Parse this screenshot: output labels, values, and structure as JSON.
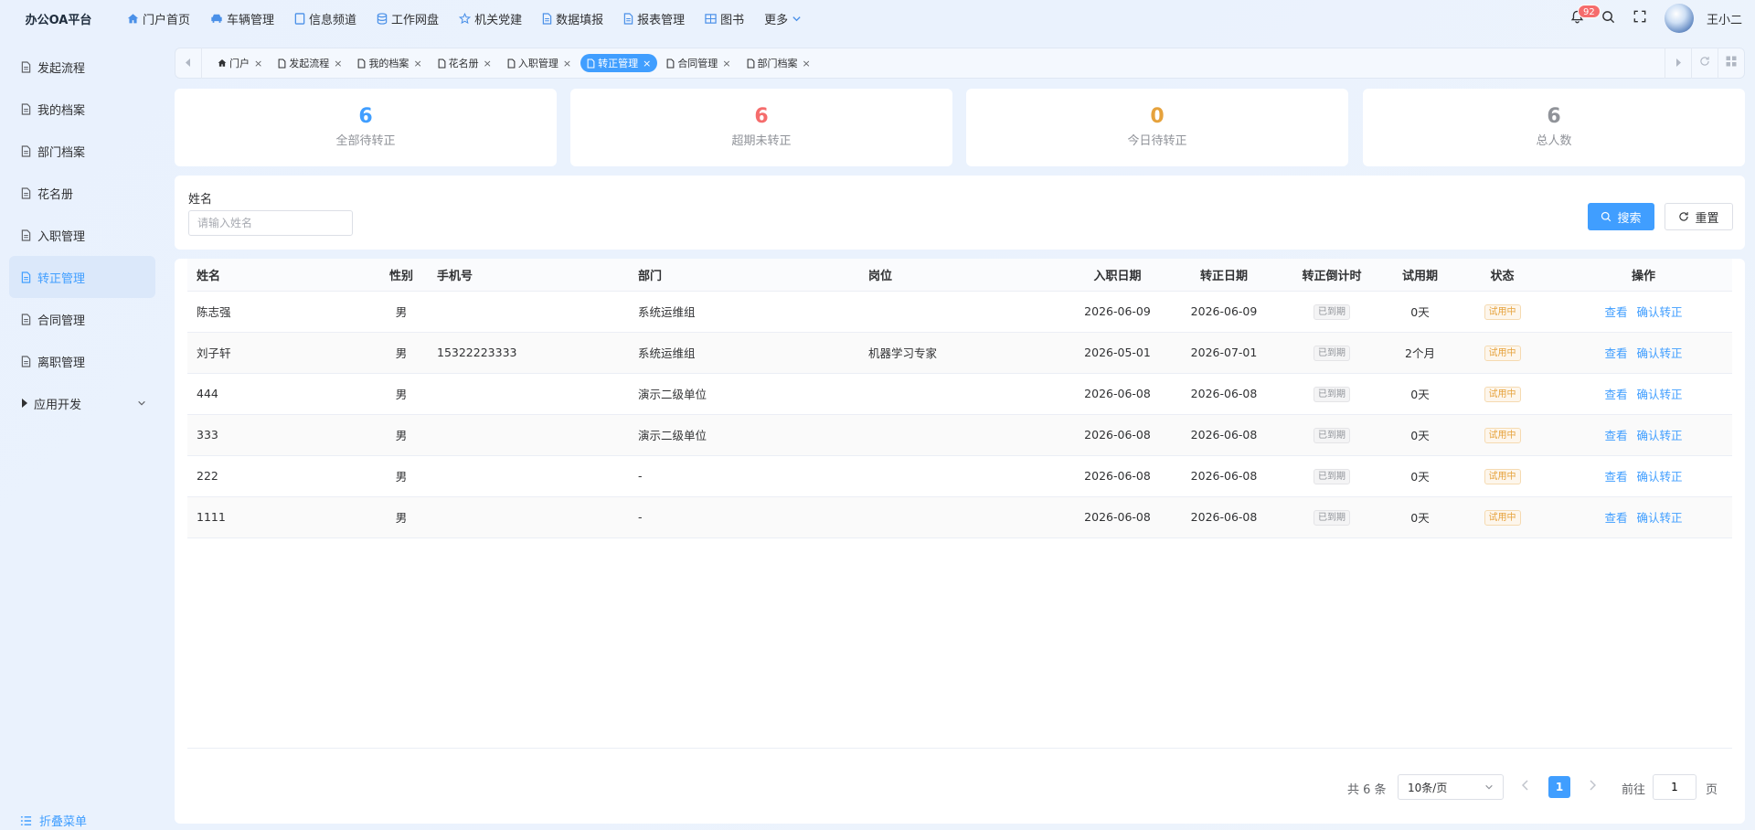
{
  "brand": "办公OA平台",
  "topnav": [
    {
      "label": "门户首页",
      "icon": "home-icon"
    },
    {
      "label": "车辆管理",
      "icon": "car-icon"
    },
    {
      "label": "信息频道",
      "icon": "channel-icon"
    },
    {
      "label": "工作网盘",
      "icon": "database-icon"
    },
    {
      "label": "机关党建",
      "icon": "star-icon"
    },
    {
      "label": "数据填报",
      "icon": "document-icon"
    },
    {
      "label": "报表管理",
      "icon": "document-icon"
    },
    {
      "label": "图书",
      "icon": "book-icon"
    },
    {
      "label": "更多",
      "icon": "chevron-down-icon"
    }
  ],
  "header": {
    "notification_count": "92",
    "username": "王小二"
  },
  "sidebar": {
    "items": [
      {
        "label": "发起流程"
      },
      {
        "label": "我的档案"
      },
      {
        "label": "部门档案"
      },
      {
        "label": "花名册"
      },
      {
        "label": "入职管理"
      },
      {
        "label": "转正管理",
        "active": true
      },
      {
        "label": "合同管理"
      },
      {
        "label": "离职管理"
      },
      {
        "label": "应用开发"
      }
    ],
    "collapse_label": "折叠菜单"
  },
  "tabs": [
    {
      "label": "门户",
      "icon": "home-icon"
    },
    {
      "label": "发起流程",
      "icon": "document-icon"
    },
    {
      "label": "我的档案",
      "icon": "document-icon"
    },
    {
      "label": "花名册",
      "icon": "document-icon"
    },
    {
      "label": "入职管理",
      "icon": "document-icon"
    },
    {
      "label": "转正管理",
      "icon": "document-icon",
      "active": true
    },
    {
      "label": "合同管理",
      "icon": "document-icon"
    },
    {
      "label": "部门档案",
      "icon": "document-icon"
    }
  ],
  "stats": [
    {
      "value": "6",
      "label": "全部待转正",
      "color": "#409eff"
    },
    {
      "value": "6",
      "label": "超期未转正",
      "color": "#f56c6c"
    },
    {
      "value": "0",
      "label": "今日待转正",
      "color": "#e6a23c"
    },
    {
      "value": "6",
      "label": "总人数",
      "color": "#909399"
    }
  ],
  "search": {
    "name_label": "姓名",
    "name_placeholder": "请输入姓名",
    "search_button": "搜索",
    "reset_button": "重置"
  },
  "table": {
    "headers": {
      "name": "姓名",
      "gender": "性别",
      "phone": "手机号",
      "dept": "部门",
      "post": "岗位",
      "entry_date": "入职日期",
      "regular_date": "转正日期",
      "countdown": "转正倒计时",
      "probation": "试用期",
      "status": "状态",
      "actions": "操作"
    },
    "rows": [
      {
        "name": "陈志强",
        "gender": "男",
        "phone": "",
        "dept": "系统运维组",
        "post": "",
        "entry_date": "2026-06-09",
        "regular_date": "2026-06-09",
        "countdown": "已到期",
        "probation": "0天",
        "status": "试用中",
        "view": "查看",
        "confirm": "确认转正"
      },
      {
        "name": "刘子轩",
        "gender": "男",
        "phone": "15322223333",
        "dept": "系统运维组",
        "post": "机器学习专家",
        "entry_date": "2026-05-01",
        "regular_date": "2026-07-01",
        "countdown": "已到期",
        "probation": "2个月",
        "status": "试用中",
        "view": "查看",
        "confirm": "确认转正"
      },
      {
        "name": "444",
        "gender": "男",
        "phone": "",
        "dept": "演示二级单位",
        "post": "",
        "entry_date": "2026-06-08",
        "regular_date": "2026-06-08",
        "countdown": "已到期",
        "probation": "0天",
        "status": "试用中",
        "view": "查看",
        "confirm": "确认转正"
      },
      {
        "name": "333",
        "gender": "男",
        "phone": "",
        "dept": "演示二级单位",
        "post": "",
        "entry_date": "2026-06-08",
        "regular_date": "2026-06-08",
        "countdown": "已到期",
        "probation": "0天",
        "status": "试用中",
        "view": "查看",
        "confirm": "确认转正"
      },
      {
        "name": "222",
        "gender": "男",
        "phone": "",
        "dept": "-",
        "post": "",
        "entry_date": "2026-06-08",
        "regular_date": "2026-06-08",
        "countdown": "已到期",
        "probation": "0天",
        "status": "试用中",
        "view": "查看",
        "confirm": "确认转正"
      },
      {
        "name": "1111",
        "gender": "男",
        "phone": "",
        "dept": "-",
        "post": "",
        "entry_date": "2026-06-08",
        "regular_date": "2026-06-08",
        "countdown": "已到期",
        "probation": "0天",
        "status": "试用中",
        "view": "查看",
        "confirm": "确认转正"
      }
    ]
  },
  "pagination": {
    "total_text": "共 6 条",
    "page_size": "10条/页",
    "current_page": "1",
    "goto_label": "前往",
    "goto_value": "1",
    "page_suffix": "页"
  }
}
